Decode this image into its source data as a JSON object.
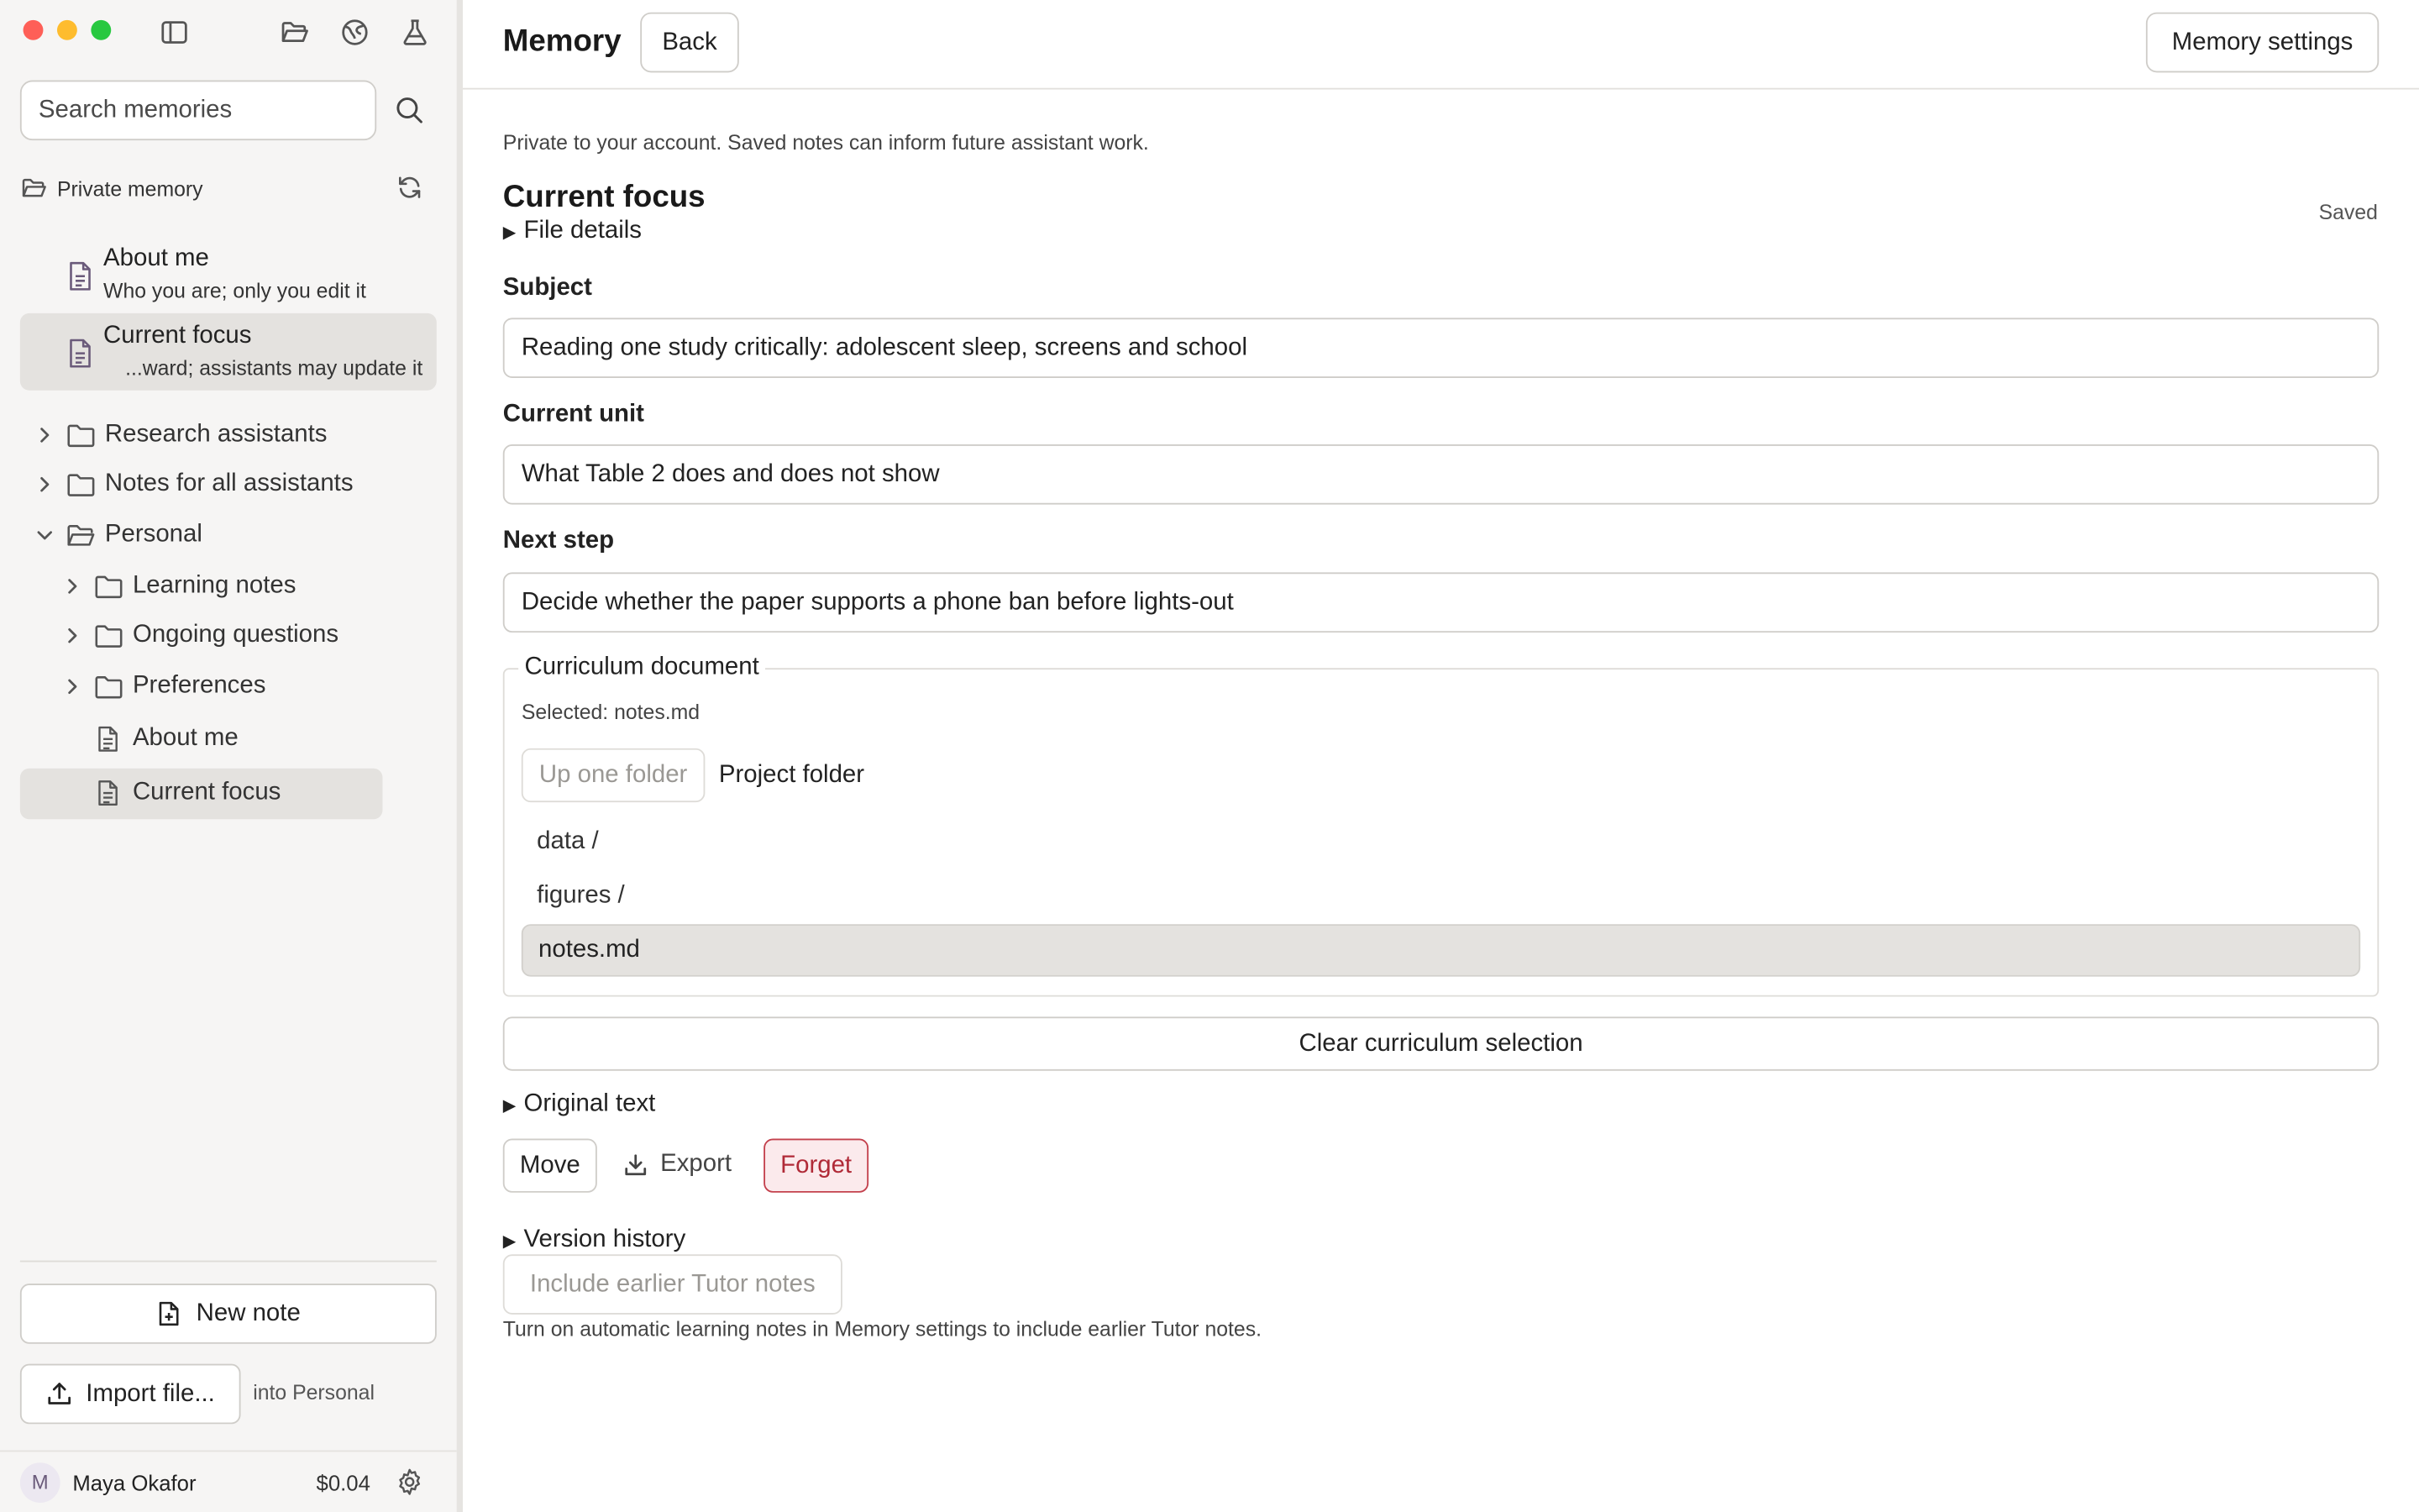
{
  "window": {
    "toolbar_icons": [
      "sidebar-toggle-icon",
      "folder-open-icon",
      "globe-icon",
      "flask-icon"
    ]
  },
  "sidebar": {
    "search_placeholder": "Search memories",
    "section_label": "Private memory",
    "pinned": [
      {
        "title": "About me",
        "subtitle": "Who you are; only you edit it"
      },
      {
        "title": "Current focus",
        "subtitle": "...ward; assistants may update it"
      }
    ],
    "tree": [
      {
        "label": "Research assistants",
        "type": "folder",
        "expanded": false
      },
      {
        "label": "Notes for all assistants",
        "type": "folder",
        "expanded": false
      },
      {
        "label": "Personal",
        "type": "folder",
        "expanded": true
      },
      {
        "label": "Learning notes",
        "type": "folder",
        "expanded": false
      },
      {
        "label": "Ongoing questions",
        "type": "folder",
        "expanded": false
      },
      {
        "label": "Preferences",
        "type": "folder",
        "expanded": false
      },
      {
        "label": "About me",
        "type": "file"
      },
      {
        "label": "Current focus",
        "type": "file",
        "selected": true
      }
    ],
    "new_note_label": "New note",
    "import_label": "Import file...",
    "import_target": "into Personal",
    "user": {
      "initial": "M",
      "name": "Maya Okafor",
      "balance": "$0.04"
    }
  },
  "header": {
    "title": "Memory",
    "back_label": "Back",
    "settings_label": "Memory settings"
  },
  "main": {
    "privacy_note": "Private to your account. Saved notes can inform future assistant work.",
    "title": "Current focus",
    "status": "Saved",
    "file_details_label": "File details",
    "fields": {
      "subject_label": "Subject",
      "subject_value": "Reading one study critically: adolescent sleep, screens and school",
      "unit_label": "Current unit",
      "unit_value": "What Table 2 does and does not show",
      "next_label": "Next step",
      "next_value": "Decide whether the paper supports a phone ban before lights-out"
    },
    "curriculum": {
      "legend": "Curriculum document",
      "selected_text": "Selected: notes.md",
      "up_label": "Up one folder",
      "folder_name": "Project folder",
      "files": [
        "data /",
        "figures /",
        "notes.md"
      ],
      "selected_file": "notes.md",
      "clear_label": "Clear curriculum selection"
    },
    "original_text_label": "Original text",
    "actions": {
      "move": "Move",
      "export": "Export",
      "forget": "Forget"
    },
    "version_history_label": "Version history",
    "include_label": "Include earlier Tutor notes",
    "hint": "Turn on automatic learning notes in Memory settings to include earlier Tutor notes."
  },
  "colors": {
    "sidebar_bg": "#f6f5f4",
    "selected_bg": "#e4e2df",
    "danger": "#b02a37",
    "traffic_red": "#fe5f57",
    "traffic_yellow": "#febc2e",
    "traffic_green": "#28c840"
  }
}
